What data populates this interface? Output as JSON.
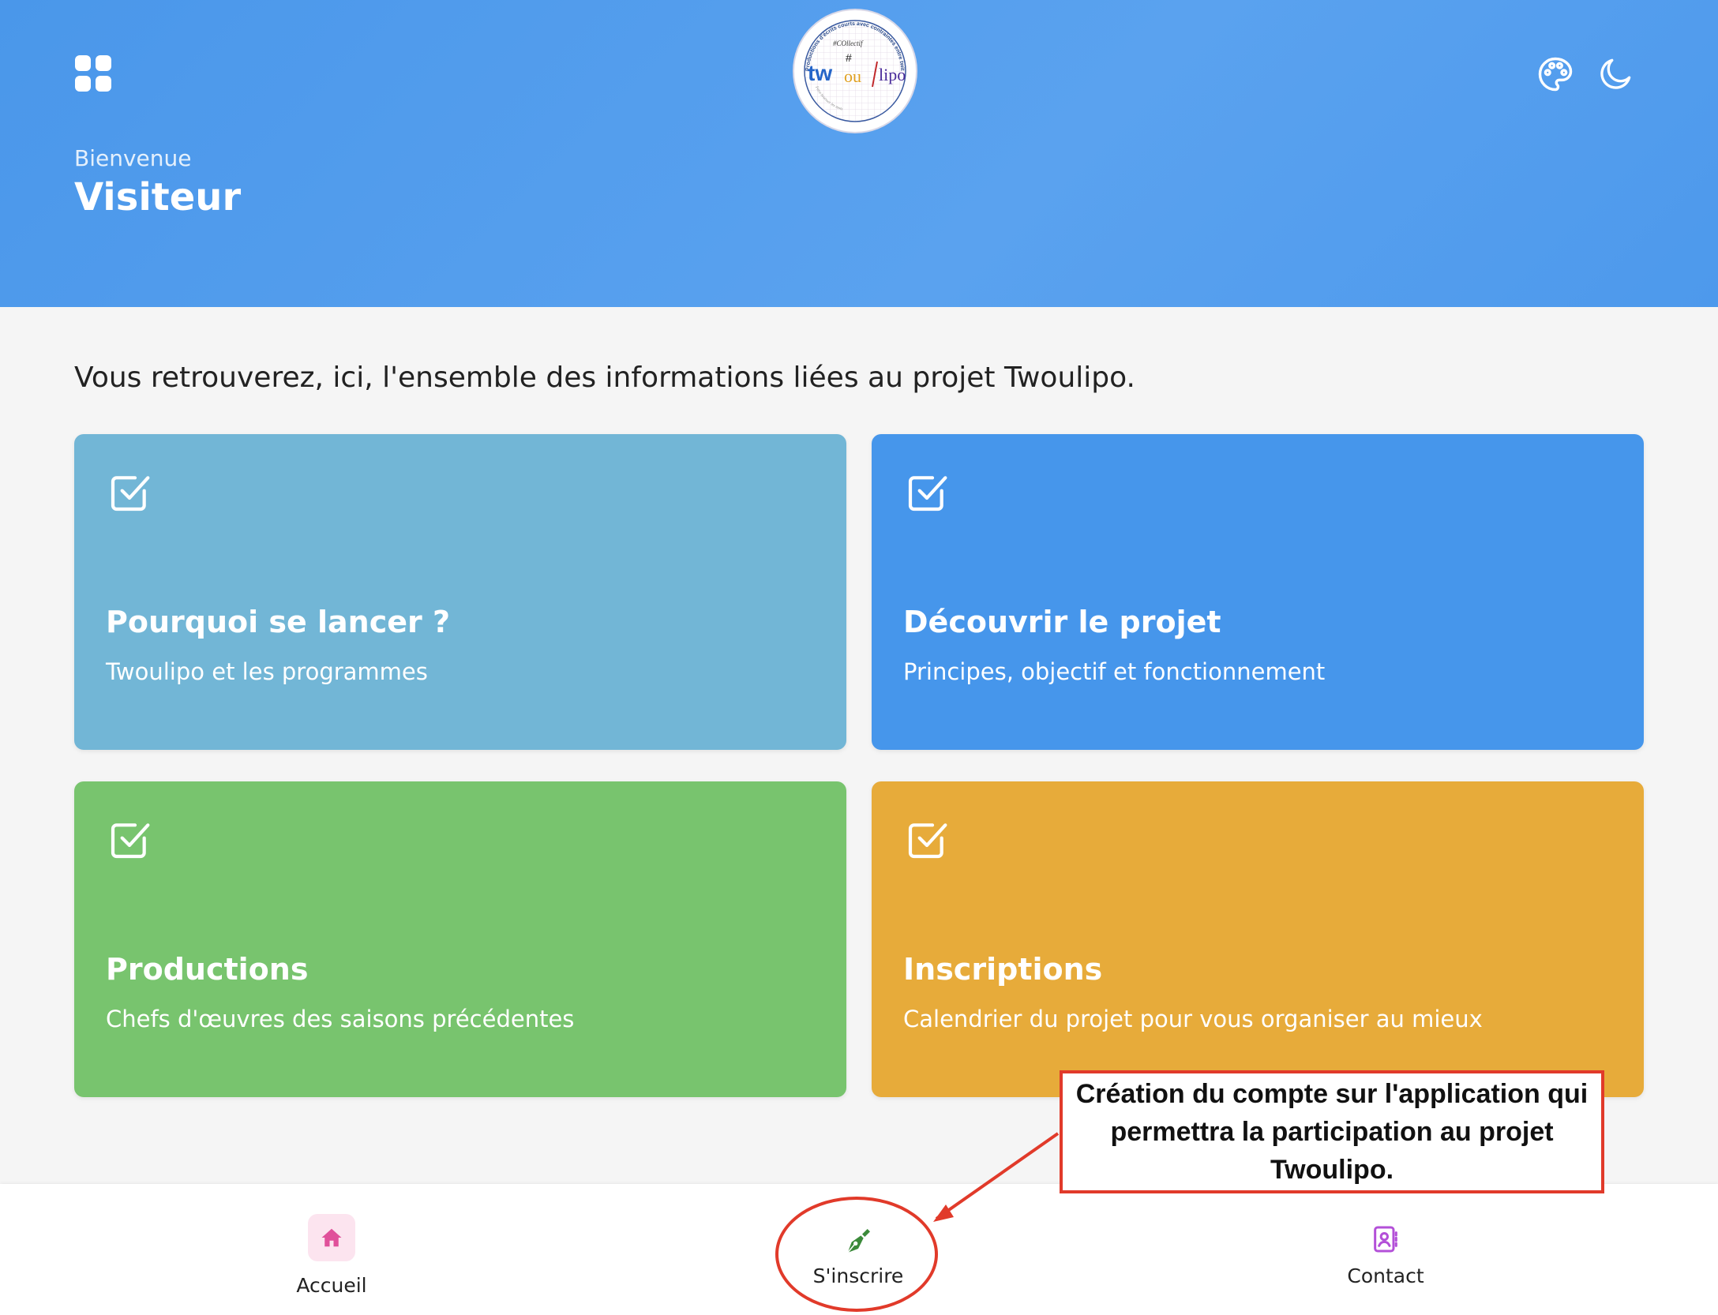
{
  "header": {
    "welcome": "Bienvenue",
    "user_name": "Visiteur",
    "logo": {
      "top_arc": "Productions d'écrits courts avec contraintes entre twittclasses",
      "collective": "#COllectif",
      "brand_tw": "tw",
      "brand_ou": "ou",
      "brand_lipo": "lipo",
      "bottom_arc": "Faire bruisser les mots"
    },
    "icons": {
      "menu": "grid-menu-icon",
      "theme": "palette-icon",
      "dark_mode": "moon-icon"
    }
  },
  "intro_text": "Vous retrouverez, ici, l'ensemble des informations liées au projet Twoulipo.",
  "cards": [
    {
      "title": "Pourquoi se lancer ?",
      "subtitle": "Twoulipo et les programmes",
      "color": "#72b6d6",
      "icon": "checkbox-icon"
    },
    {
      "title": "Découvrir le projet",
      "subtitle": "Principes, objectif et fonctionnement",
      "color": "#4696eb",
      "icon": "checkbox-icon"
    },
    {
      "title": "Productions",
      "subtitle": "Chefs d'œuvres des saisons précédentes",
      "color": "#78c46e",
      "icon": "checkbox-icon"
    },
    {
      "title": "Inscriptions",
      "subtitle": "Calendrier du projet pour vous organiser au mieux",
      "color": "#e7ab3a",
      "icon": "checkbox-icon"
    }
  ],
  "bottom_nav": [
    {
      "label": "Accueil",
      "icon": "home-icon",
      "color": "#e0509a"
    },
    {
      "label": "S'inscrire",
      "icon": "pen-nib-icon",
      "color": "#3b8a3a"
    },
    {
      "label": "Contact",
      "icon": "contact-book-icon",
      "color": "#b350d8"
    }
  ],
  "annotation": {
    "text": "Création du compte sur l'application qui permettra la participation au projet Twoulipo.",
    "color": "#e13a2a"
  }
}
